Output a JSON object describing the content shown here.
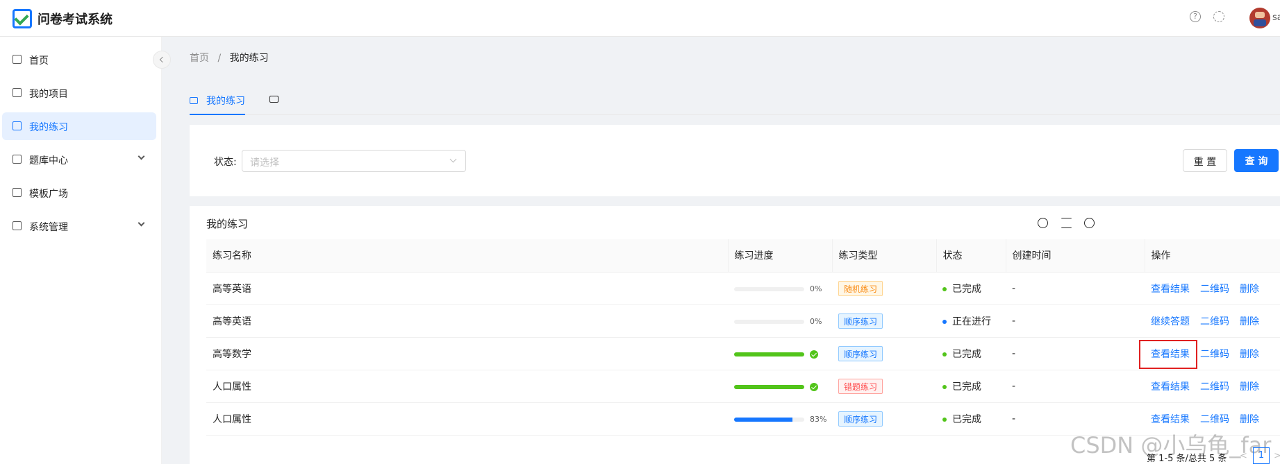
{
  "header": {
    "app_title": "问卷考试系统",
    "help_icon": "?",
    "user_name": "sa"
  },
  "sidebar": {
    "items": [
      {
        "label": "首页",
        "icon": "home-icon"
      },
      {
        "label": "我的项目",
        "icon": "project-icon"
      },
      {
        "label": "我的练习",
        "icon": "edit-icon",
        "active": true
      },
      {
        "label": "题库中心",
        "icon": "bank-icon",
        "expandable": true
      },
      {
        "label": "模板广场",
        "icon": "copy-icon"
      },
      {
        "label": "系统管理",
        "icon": "settings-icon",
        "expandable": true
      }
    ]
  },
  "breadcrumb": [
    "首页",
    "/",
    "我的练习"
  ],
  "tabs": {
    "active_label": "我的练习"
  },
  "filter": {
    "label": "状态:",
    "placeholder": "请选择",
    "reset_label": "重 置",
    "query_label": "查 询"
  },
  "table": {
    "title": "我的练习",
    "columns": [
      "练习名称",
      "练习进度",
      "练习类型",
      "状态",
      "创建时间",
      "操作"
    ],
    "rows": [
      {
        "name": "高等英语",
        "progress": 0,
        "progress_text": "0%",
        "type": "随机练习",
        "status": "已完成",
        "created": "-",
        "actions": [
          "查看结果",
          "二维码",
          "删除"
        ]
      },
      {
        "name": "高等英语",
        "progress": 0,
        "progress_text": "0%",
        "type": "顺序练习",
        "status": "正在进行",
        "created": "-",
        "actions": [
          "继续答题",
          "二维码",
          "删除"
        ]
      },
      {
        "name": "高等数学",
        "progress": 100,
        "progress_text": "",
        "type": "顺序练习",
        "status": "已完成",
        "created": "-",
        "actions": [
          "查看结果",
          "二维码",
          "删除"
        ]
      },
      {
        "name": "人口属性",
        "progress": 100,
        "progress_text": "",
        "type": "错题练习",
        "status": "已完成",
        "created": "-",
        "actions": [
          "查看结果",
          "二维码",
          "删除"
        ]
      },
      {
        "name": "人口属性",
        "progress": 83,
        "progress_text": "83%",
        "type": "顺序练习",
        "status": "已完成",
        "created": "-",
        "actions": [
          "查看结果",
          "二维码",
          "删除"
        ]
      }
    ]
  },
  "pagination": {
    "summary": "第 1-5 条/总共 5 条",
    "current_page": "1",
    "prev": "<",
    "next": ">"
  },
  "watermark": "CSDN @小乌龟_far",
  "colors": {
    "primary": "#1677ff",
    "success": "#52c41a",
    "highlight": "#e02020"
  }
}
